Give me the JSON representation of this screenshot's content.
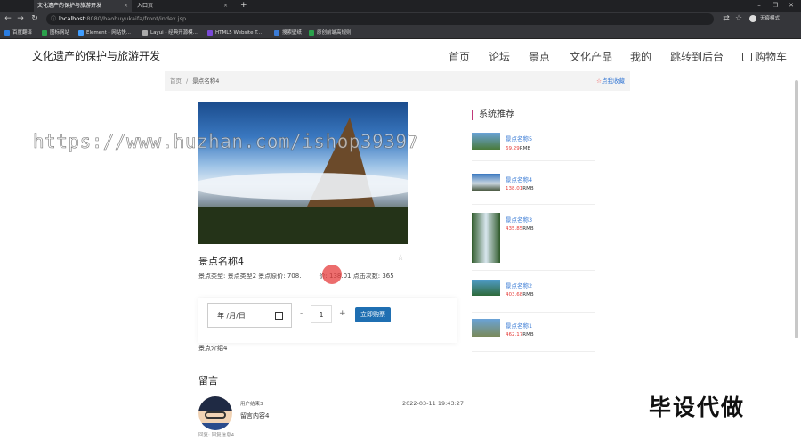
{
  "browser": {
    "tabs": [
      {
        "label": "文化遗产的保护与旅游开发"
      },
      {
        "label": "入口页"
      }
    ],
    "new_tab": "+",
    "url_host": "localhost",
    "url_path": ":8080/baohuyukaifa/front/index.jsp",
    "controls": {
      "minimize": "–",
      "restore": "❐",
      "close": "✕"
    },
    "profile": "无痕模式",
    "bookmarks": [
      {
        "label": "百度翻译",
        "color": "#2a7de1"
      },
      {
        "label": "图标网站",
        "color": "#2ba24c"
      },
      {
        "label": "Element - 网站快...",
        "color": "#409eff"
      },
      {
        "label": "Layui - 经典开源模...",
        "color": "#aaaaaa"
      },
      {
        "label": "HTML5 Website T...",
        "color": "#7a4ad8"
      },
      {
        "label": "搜索壁纸",
        "color": "#3a7bd5"
      },
      {
        "label": "原创前端高规则",
        "color": "#2ba24c"
      }
    ]
  },
  "header": {
    "site_title": "文化遗产的保护与旅游开发",
    "nav": [
      "首页",
      "论坛",
      "景点",
      "文化产品",
      "我的",
      "跳转到后台",
      "购物车"
    ]
  },
  "breadcrumb": {
    "home": "首页",
    "sep": "/",
    "current": "景点名称4",
    "collect": "点我收藏",
    "collect_icon": "☆"
  },
  "product": {
    "name": "景点名称4",
    "info": "景点类型:   景点类型2   景点原价:   708.",
    "info2": "价:   138.01   点击次数:   365",
    "date_placeholder": "年 /月/日",
    "minus": "-",
    "qty": "1",
    "plus": "+",
    "buy_label": "立即购票",
    "intro": "景点介绍4"
  },
  "comments": {
    "title": "留言",
    "items": [
      {
        "user": "用户结束3",
        "time": "2022-03-11 19:43:27",
        "text": "留言内容4",
        "reply": "回复:  回复信息4"
      }
    ]
  },
  "recommend": {
    "title": "系统推荐",
    "items": [
      {
        "name": "景点名称5",
        "price": "69.29",
        "unit": "RMB"
      },
      {
        "name": "景点名称4",
        "price": "138.01",
        "unit": "RMB"
      },
      {
        "name": "景点名称3",
        "price": "435.85",
        "unit": "RMB"
      },
      {
        "name": "景点名称2",
        "price": "403.68",
        "unit": "RMB"
      },
      {
        "name": "景点名称1",
        "price": "462.17",
        "unit": "RMB"
      }
    ]
  },
  "overlay": {
    "watermark": "https://www.huzhan.com/ishop39397",
    "corner_text": "毕设代做"
  }
}
